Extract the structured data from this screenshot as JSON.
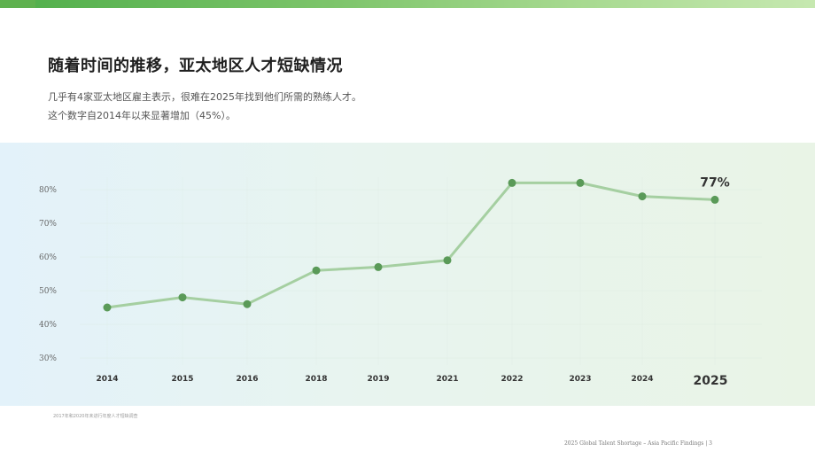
{
  "page": {
    "title": "随着时间的推移，亚太地区人才短缺情况",
    "subtitle_line1": "几乎有4家亚太地区雇主表示，很难在2025年找到他们所需的熟练人才。",
    "subtitle_line2": "这个数字自2014年以来显著增加（45%）。",
    "footnote": "2017年和2020年未进行年度人才短缺调查",
    "footer": "2025 Global Talent Shortage – Asia Pacific Findings | 3"
  },
  "colors": {
    "line": "#a5cfa1",
    "marker": "#5a9a58",
    "grid": "#d6e6dc"
  },
  "chart_data": {
    "type": "line",
    "title": "",
    "xlabel": "",
    "ylabel": "",
    "categories": [
      "2014",
      "2015",
      "2016",
      "2018",
      "2019",
      "2021",
      "2022",
      "2023",
      "2024",
      "2025"
    ],
    "series": [
      {
        "values": [
          45,
          48,
          46,
          56,
          57,
          59,
          82,
          82,
          78,
          77
        ]
      }
    ],
    "y_ticks": [
      "30%",
      "40%",
      "50%",
      "60%",
      "70%",
      "80%"
    ],
    "ylim": [
      30,
      80
    ],
    "highlight_label": "77%",
    "highlight_category": "2025",
    "grid": true,
    "legend": "none"
  }
}
